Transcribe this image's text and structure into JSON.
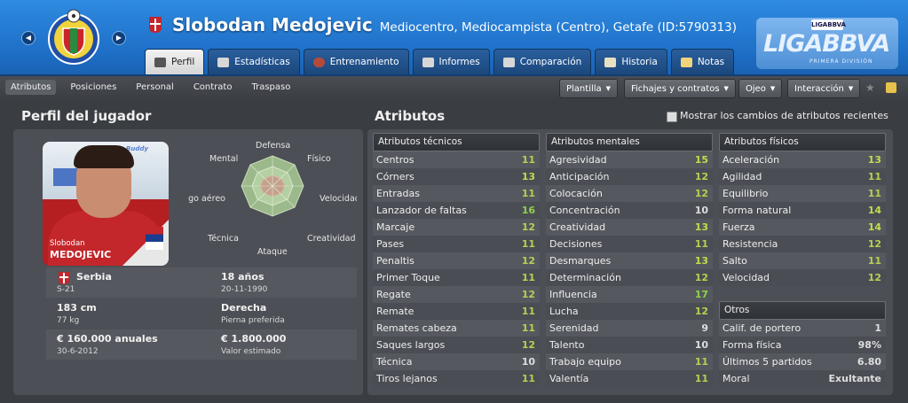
{
  "header": {
    "player_name": "Slobodan Medojevic",
    "subtitle": "Mediocentro, Mediocampista (Centro), Getafe (ID:5790313)",
    "club_crest_label": "GETAFE C.F.",
    "liga_logo_top": "LIGABBVA",
    "liga_logo_main": "LIGABBVA",
    "liga_logo_sub": "PRIMERA DIVISIÓN",
    "tabs": [
      {
        "label": "Perfil",
        "active": true
      },
      {
        "label": "Estadísticas"
      },
      {
        "label": "Entrenamiento"
      },
      {
        "label": "Informes"
      },
      {
        "label": "Comparación"
      },
      {
        "label": "Historia"
      },
      {
        "label": "Notas"
      }
    ]
  },
  "subnav": {
    "items": [
      "Atributos",
      "Posiciones",
      "Personal",
      "Contrato",
      "Traspaso"
    ],
    "active": "Atributos"
  },
  "toolbar": {
    "plantilla": "Plantilla",
    "fichajes": "Fichajes y contratos",
    "ojeo": "Ojeo",
    "interaccion": "Interacción"
  },
  "profile": {
    "section_title": "Perfil del jugador",
    "photo_first": "Slobodan",
    "photo_last": "MEDOJEVIC",
    "photo_logo": "Buddy",
    "radar_labels": {
      "defensa": "Defensa",
      "fisico": "Físico",
      "velocidad": "Velocidad",
      "creatividad": "Creatividad",
      "ataque": "Ataque",
      "tecnica": "Técnica",
      "juego_aereo": "Juego aéreo",
      "mental": "Mental"
    },
    "nationality": "Serbia",
    "nationality_sub": "S-21",
    "age": "18 años",
    "birth": "20-11-1990",
    "height": "183 cm",
    "weight": "77 kg",
    "foot": "Derecha",
    "foot_sub": "Pierna preferida",
    "wage": "€ 160.000 anuales",
    "contract_end": "30-6-2012",
    "value": "€ 1.800.000",
    "value_sub": "Valor estimado"
  },
  "attributes": {
    "section_title": "Atributos",
    "show_changes_label": "Mostrar los cambios de atributos recientes",
    "technical": {
      "title": "Atributos técnicos",
      "rows": [
        {
          "name": "Centros",
          "value": "11"
        },
        {
          "name": "Córners",
          "value": "13"
        },
        {
          "name": "Entradas",
          "value": "11"
        },
        {
          "name": "Lanzador de faltas",
          "value": "16"
        },
        {
          "name": "Marcaje",
          "value": "12"
        },
        {
          "name": "Pases",
          "value": "11"
        },
        {
          "name": "Penaltis",
          "value": "12"
        },
        {
          "name": "Primer Toque",
          "value": "11"
        },
        {
          "name": "Regate",
          "value": "12"
        },
        {
          "name": "Remate",
          "value": "11"
        },
        {
          "name": "Remates cabeza",
          "value": "11"
        },
        {
          "name": "Saques largos",
          "value": "12"
        },
        {
          "name": "Técnica",
          "value": "10"
        },
        {
          "name": "Tiros lejanos",
          "value": "11"
        }
      ]
    },
    "mental": {
      "title": "Atributos mentales",
      "rows": [
        {
          "name": "Agresividad",
          "value": "15"
        },
        {
          "name": "Anticipación",
          "value": "12"
        },
        {
          "name": "Colocación",
          "value": "12"
        },
        {
          "name": "Concentración",
          "value": "10"
        },
        {
          "name": "Creatividad",
          "value": "13"
        },
        {
          "name": "Decisiones",
          "value": "11"
        },
        {
          "name": "Desmarques",
          "value": "13"
        },
        {
          "name": "Determinación",
          "value": "12"
        },
        {
          "name": "Influencia",
          "value": "17"
        },
        {
          "name": "Lucha",
          "value": "12"
        },
        {
          "name": "Serenidad",
          "value": "9"
        },
        {
          "name": "Talento",
          "value": "10"
        },
        {
          "name": "Trabajo equipo",
          "value": "11"
        },
        {
          "name": "Valentía",
          "value": "11"
        }
      ]
    },
    "physical": {
      "title": "Atributos físicos",
      "rows": [
        {
          "name": "Aceleración",
          "value": "13"
        },
        {
          "name": "Agilidad",
          "value": "11"
        },
        {
          "name": "Equilibrio",
          "value": "11"
        },
        {
          "name": "Forma natural",
          "value": "14"
        },
        {
          "name": "Fuerza",
          "value": "14"
        },
        {
          "name": "Resistencia",
          "value": "12"
        },
        {
          "name": "Salto",
          "value": "11"
        },
        {
          "name": "Velocidad",
          "value": "12"
        }
      ]
    },
    "others": {
      "title": "Otros",
      "rows": [
        {
          "name": "Calif. de portero",
          "value": "1"
        },
        {
          "name": "Forma física",
          "value": "98%"
        },
        {
          "name": "Últimos 5 partidos",
          "value": "6.80"
        },
        {
          "name": "Moral",
          "value": "Exultante"
        }
      ]
    }
  }
}
